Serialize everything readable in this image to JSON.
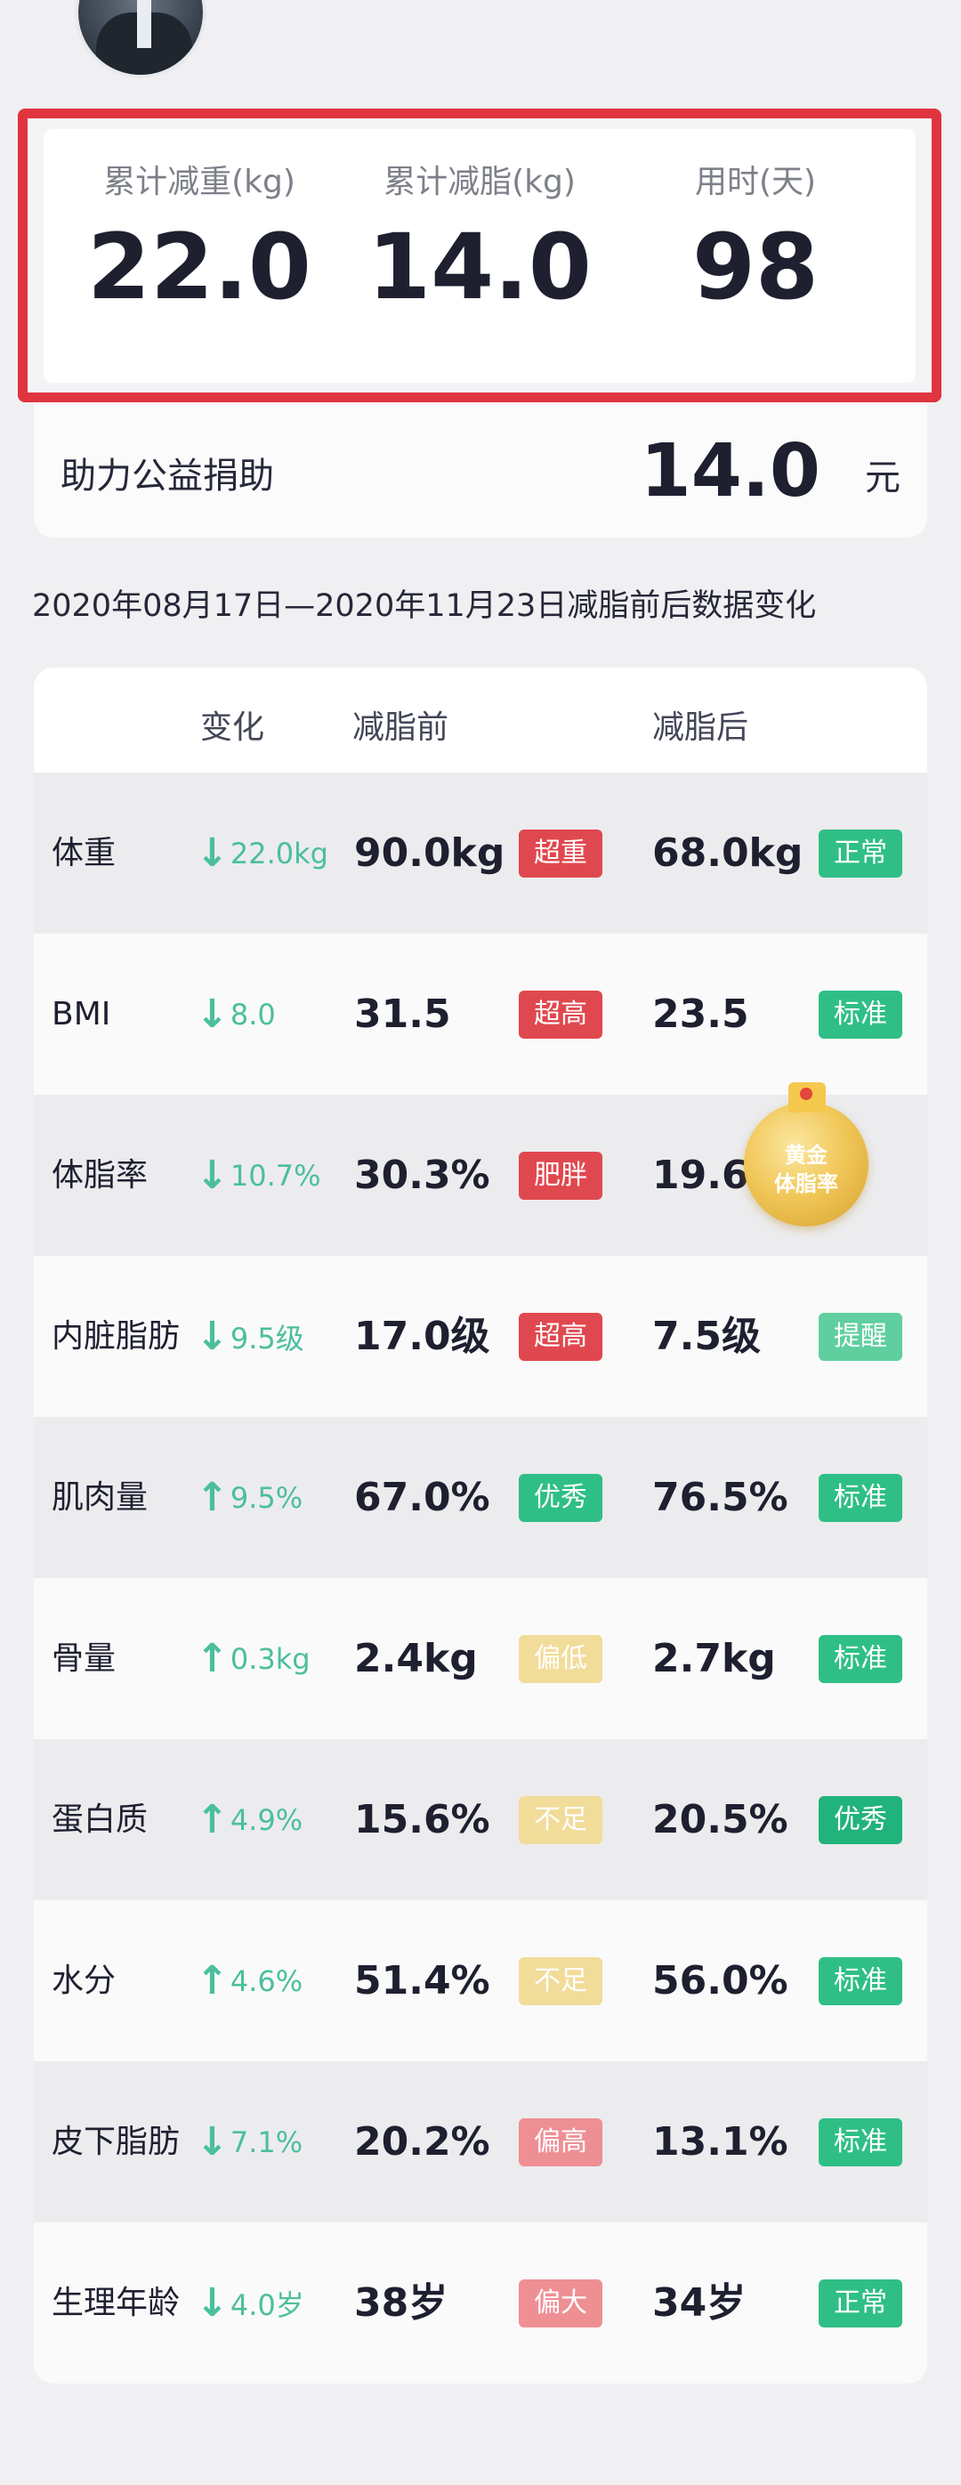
{
  "profile": {
    "name_fragment": ""
  },
  "summary": {
    "stats": [
      {
        "label": "累计减重(kg)",
        "value": "22.0"
      },
      {
        "label": "累计减脂(kg)",
        "value": "14.0"
      },
      {
        "label": "用时(天)",
        "value": "98"
      }
    ],
    "border_color": "#e0343f"
  },
  "donation": {
    "label": "助力公益捐助",
    "amount": "14.0",
    "unit": "元"
  },
  "period_text": "2020年08月17日—2020年11月23日减脂前后数据变化",
  "table": {
    "headers": {
      "change": "变化",
      "before": "减脂前",
      "after": "减脂后"
    },
    "rows": [
      {
        "name": "体重",
        "dir": "down",
        "change": "22.0kg",
        "before": "90.0kg",
        "before_tag": "超重",
        "before_color": "#e0484f",
        "after": "68.0kg",
        "after_tag": "正常",
        "after_color": "#2fbf86"
      },
      {
        "name": "BMI",
        "dir": "down",
        "change": "8.0",
        "before": "31.5",
        "before_tag": "超高",
        "before_color": "#e0484f",
        "after": "23.5",
        "after_tag": "标准",
        "after_color": "#2fbf86"
      },
      {
        "name": "体脂率",
        "dir": "down",
        "change": "10.7%",
        "before": "30.3%",
        "before_tag": "肥胖",
        "before_color": "#e0484f",
        "after": "19.6%",
        "after_tag": "",
        "after_color": ""
      },
      {
        "name": "内脏脂肪",
        "dir": "down",
        "change": "9.5级",
        "before": "17.0级",
        "before_tag": "超高",
        "before_color": "#e0484f",
        "after": "7.5级",
        "after_tag": "提醒",
        "after_color": "#5fcf9f"
      },
      {
        "name": "肌肉量",
        "dir": "up",
        "change": "9.5%",
        "before": "67.0%",
        "before_tag": "优秀",
        "before_color": "#2fbf86",
        "after": "76.5%",
        "after_tag": "标准",
        "after_color": "#2fbf86"
      },
      {
        "name": "骨量",
        "dir": "up",
        "change": "0.3kg",
        "before": "2.4kg",
        "before_tag": "偏低",
        "before_color": "#f2dc9a",
        "after": "2.7kg",
        "after_tag": "标准",
        "after_color": "#2fbf86"
      },
      {
        "name": "蛋白质",
        "dir": "up",
        "change": "4.9%",
        "before": "15.6%",
        "before_tag": "不足",
        "before_color": "#f2dc9a",
        "after": "20.5%",
        "after_tag": "优秀",
        "after_color": "#21b37c"
      },
      {
        "name": "水分",
        "dir": "up",
        "change": "4.6%",
        "before": "51.4%",
        "before_tag": "不足",
        "before_color": "#f2dc9a",
        "after": "56.0%",
        "after_tag": "标准",
        "after_color": "#2fbf86"
      },
      {
        "name": "皮下脂肪",
        "dir": "down",
        "change": "7.1%",
        "before": "20.2%",
        "before_tag": "偏高",
        "before_color": "#ee8f94",
        "after": "13.1%",
        "after_tag": "标准",
        "after_color": "#2fbf86"
      },
      {
        "name": "生理年龄",
        "dir": "down",
        "change": "4.0岁",
        "before": "38岁",
        "before_tag": "偏大",
        "before_color": "#ee8f94",
        "after": "34岁",
        "after_tag": "正常",
        "after_color": "#2fbf86"
      }
    ]
  },
  "badge": {
    "line1": "黄金",
    "line2": "体脂率",
    "icon": "gold-medal-icon"
  }
}
